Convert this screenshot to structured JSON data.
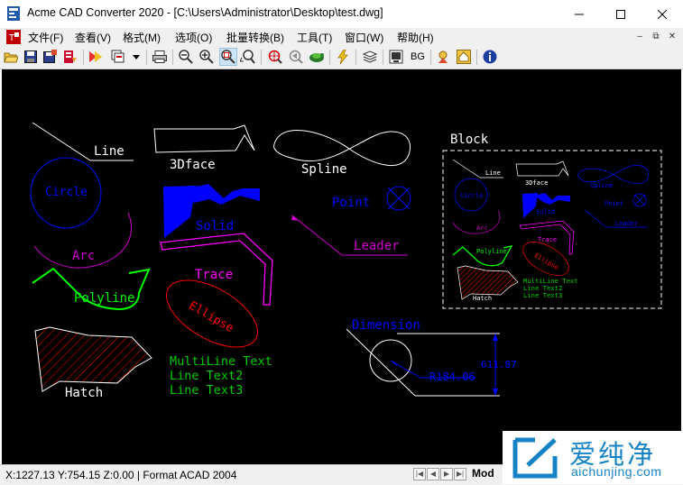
{
  "window": {
    "title": "Acme CAD Converter 2020 - [C:\\Users\\Administrator\\Desktop\\test.dwg]",
    "controls": [
      "minimize",
      "maximize",
      "close"
    ]
  },
  "menubar": {
    "items": [
      {
        "label": "文件(F)"
      },
      {
        "label": "查看(V)"
      },
      {
        "label": "格式(M)"
      },
      {
        "label": "选项(O)"
      },
      {
        "label": "批量转换(B)"
      },
      {
        "label": "工具(T)"
      },
      {
        "label": "窗口(W)"
      },
      {
        "label": "帮助(H)"
      }
    ]
  },
  "toolbar": {
    "buttons": [
      "open-icon",
      "save-icon",
      "save-as-icon",
      "export-icon",
      "convert-icon",
      "batch-icon",
      "dropdown-icon",
      "print-icon",
      "zoom-out-icon",
      "zoom-in-icon",
      "zoom-window-icon",
      "zoom-realtime-icon",
      "zoom-extents-icon",
      "zoom-previous-icon",
      "pan-icon",
      "lightning-icon",
      "layers-icon",
      "display-icon",
      "bg-button",
      "find-icon",
      "home-icon",
      "info-icon"
    ],
    "bg_label": "BG"
  },
  "drawing": {
    "labels": {
      "line": "Line",
      "face3d": "3Dface",
      "spline": "Spline",
      "circle": "Circle",
      "solid": "Solid",
      "point": "Point",
      "arc": "Arc",
      "leader": "Leader",
      "trace": "Trace",
      "polyline": "Polyline",
      "ellipse": "Ellipse",
      "hatch": "Hatch",
      "mtext1": "MultiLine Text",
      "mtext2": "Line Text2",
      "mtext3": "Line Text3",
      "dimension": "Dimension",
      "radius_dim": "R184.06",
      "linear_dim": "611.87",
      "block": "Block"
    },
    "colors": {
      "background": "#000000",
      "white": "#ffffff",
      "blue": "#0000ff",
      "magenta": "#ff00ff",
      "green": "#00ff00",
      "red": "#ff0000"
    }
  },
  "statusbar": {
    "coords": "X:1227.13 Y:754.15 Z:0.00 | Format ACAD 2004",
    "layout_tab": "Mod"
  },
  "watermark": {
    "brand_cn": "爱纯净",
    "url": "aichunjing.com"
  }
}
